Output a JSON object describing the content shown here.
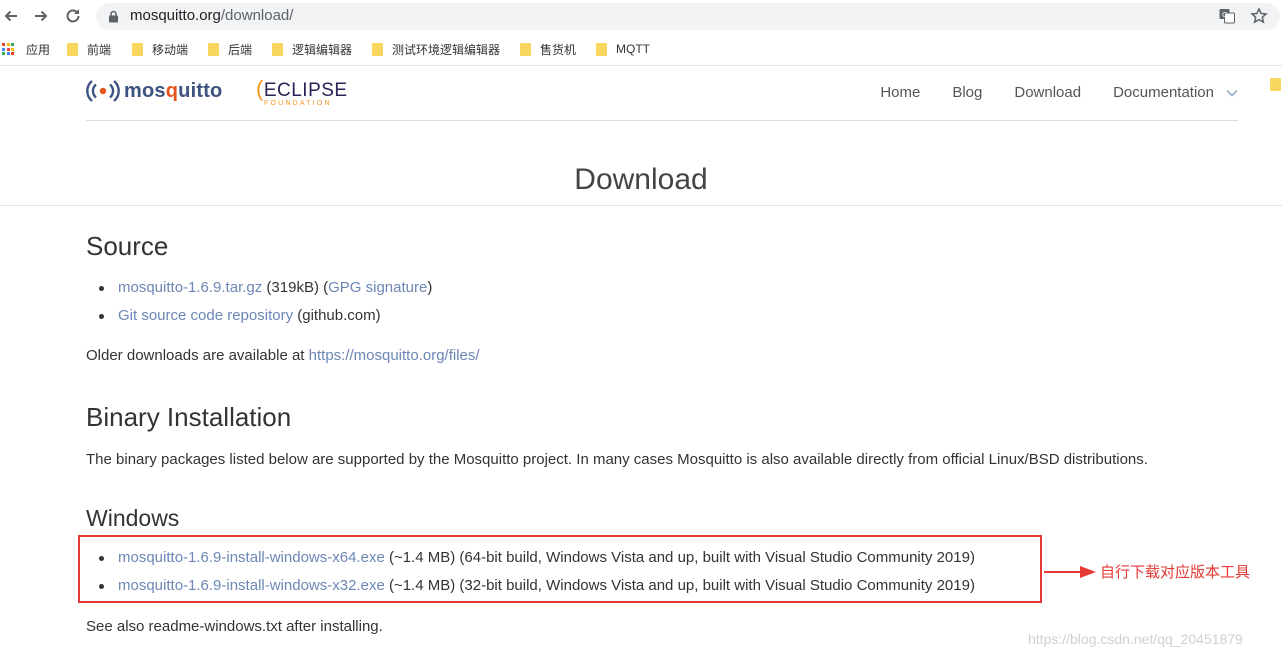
{
  "browser": {
    "url_host": "mosquitto.org",
    "url_path": "/download/",
    "bookmarks": [
      {
        "label": "应用",
        "type": "apps"
      },
      {
        "label": "前端",
        "type": "folder"
      },
      {
        "label": "移动端",
        "type": "folder"
      },
      {
        "label": "后端",
        "type": "folder"
      },
      {
        "label": "逻辑编辑器",
        "type": "folder"
      },
      {
        "label": "测试环境逻辑编辑器",
        "type": "folder"
      },
      {
        "label": "售货机",
        "type": "folder"
      },
      {
        "label": "MQTT",
        "type": "folder"
      }
    ]
  },
  "site": {
    "logo_text_a": "mos",
    "logo_text_q": "q",
    "logo_text_b": "uitto",
    "eclipse_word": "ECLIPSE",
    "eclipse_sub": "FOUNDATION",
    "nav": [
      "Home",
      "Blog",
      "Download",
      "Documentation"
    ]
  },
  "page": {
    "title": "Download",
    "source": {
      "heading": "Source",
      "items": [
        {
          "link": "mosquitto-1.6.9.tar.gz",
          "mid": " (319kB) (",
          "link2": "GPG signature",
          "tail": ")"
        },
        {
          "link": "Git source code repository",
          "tail": " (github.com)"
        }
      ],
      "older_text": "Older downloads are available at ",
      "older_link": "https://mosquitto.org/files/"
    },
    "binary": {
      "heading": "Binary Installation",
      "text": "The binary packages listed below are supported by the Mosquitto project. In many cases Mosquitto is also available directly from official Linux/BSD distributions."
    },
    "windows": {
      "heading": "Windows",
      "items": [
        {
          "link": "mosquitto-1.6.9-install-windows-x64.exe",
          "tail": " (~1.4 MB) (64-bit build, Windows Vista and up, built with Visual Studio Community 2019)"
        },
        {
          "link": "mosquitto-1.6.9-install-windows-x32.exe",
          "tail": " (~1.4 MB) (32-bit build, Windows Vista and up, built with Visual Studio Community 2019)"
        }
      ],
      "note": "See also readme-windows.txt after installing."
    }
  },
  "annotation": {
    "text": "自行下载对应版本工具",
    "color": "#e53935"
  },
  "watermark": "https://blog.csdn.net/qq_20451879",
  "colors": {
    "link": "#6c87b5",
    "brand_blue": "#3c5280",
    "eclipse_orange": "#f7941e"
  }
}
